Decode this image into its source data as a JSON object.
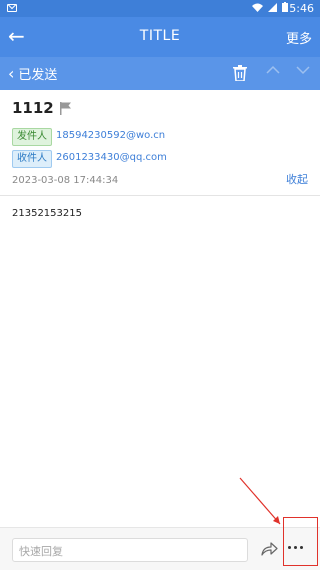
{
  "status_bar": {
    "time": "5:46"
  },
  "app_bar": {
    "back_glyph": "←",
    "title": "TITLE",
    "more_label": "更多"
  },
  "sub_bar": {
    "back_glyph": "‹",
    "folder_label": "已发送"
  },
  "message": {
    "subject": "1112",
    "sender_tag": "发件人",
    "sender_address": "18594230592@wo.cn",
    "receiver_tag": "收件人",
    "receiver_address": "2601233430@qq.com",
    "date": "2023-03-08 17:44:34",
    "collapse_label": "收起",
    "body": "21352153215"
  },
  "bottom_bar": {
    "quick_reply_placeholder": "快速回复"
  },
  "colors": {
    "accent": "#4a8ae4",
    "highlight": "#e0322b"
  }
}
